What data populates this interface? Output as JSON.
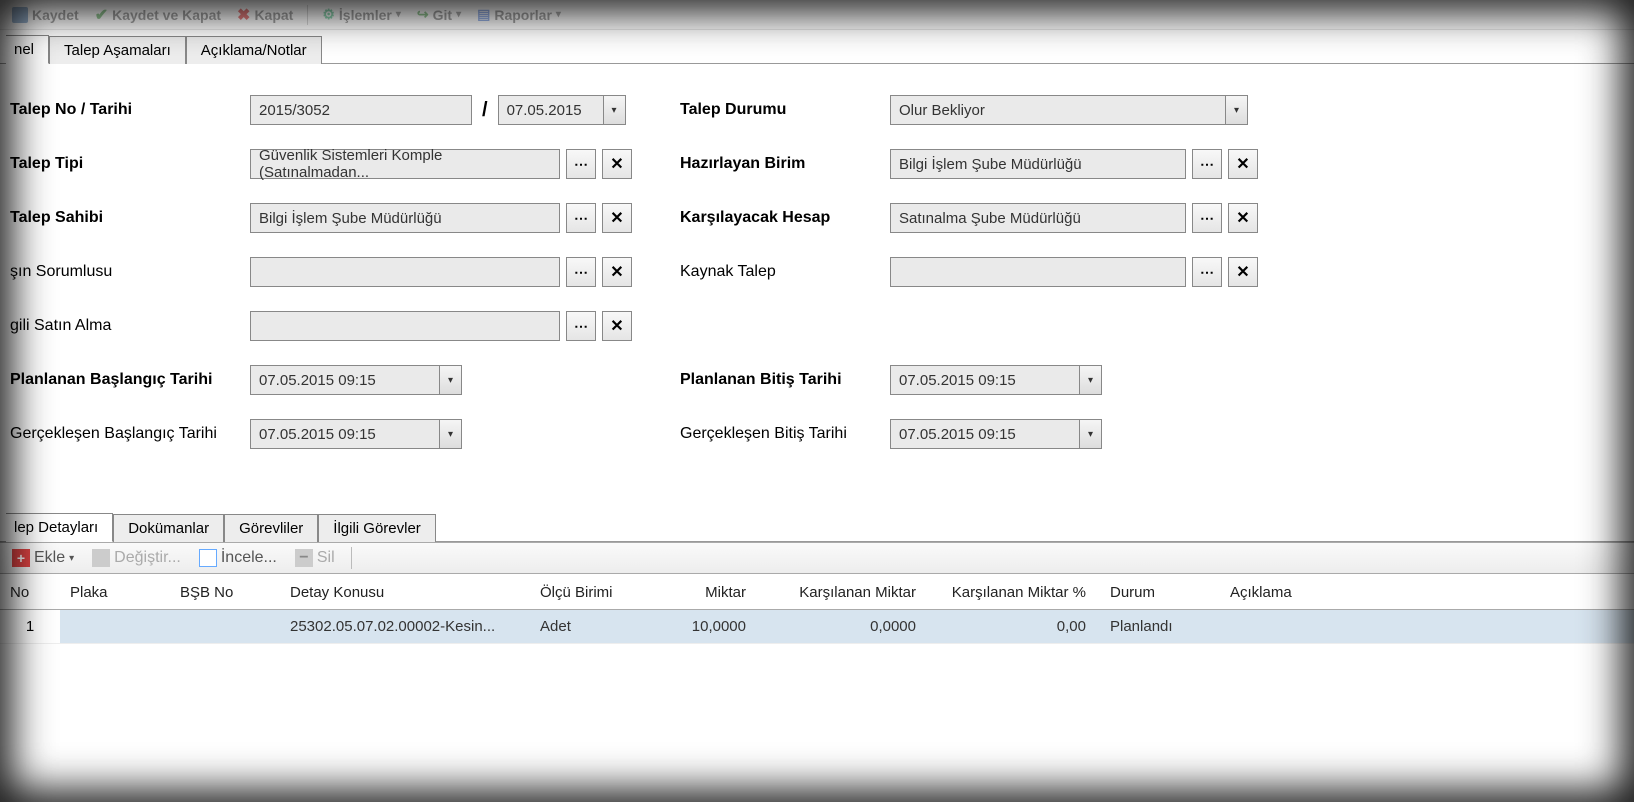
{
  "toolbar": {
    "save": "Kaydet",
    "save_close": "Kaydet ve Kapat",
    "close": "Kapat",
    "ops": "İşlemler",
    "go": "Git",
    "reports": "Raporlar"
  },
  "tabs_main": {
    "general": "nel",
    "stages": "Talep Aşamaları",
    "notes": "Açıklama/Notlar"
  },
  "labels": {
    "talep_no_tarih": "Talep No  / Tarihi",
    "talep_tipi": "Talep Tipi",
    "talep_sahibi": "Talep Sahibi",
    "isin_sorumlusu": "şın Sorumlusu",
    "ilgili_satin_alma": "gili Satın Alma",
    "plan_baslangic": "Planlanan Başlangıç Tarihi",
    "gercek_baslangic": "Gerçekleşen Başlangıç Tarihi",
    "talep_durumu": "Talep Durumu",
    "hazirlayan_birim": "Hazırlayan Birim",
    "karsilayacak_hesap": "Karşılayacak Hesap",
    "kaynak_talep": "Kaynak Talep",
    "plan_bitis": "Planlanan Bitiş Tarihi",
    "gercek_bitis": "Gerçekleşen Bitiş Tarihi"
  },
  "values": {
    "talep_no": "2015/3052",
    "talep_tarihi": "07.05.2015",
    "talep_tipi": "Güvenlik Sistemleri Komple (Satınalmadan...",
    "talep_sahibi": "Bilgi İşlem Şube Müdürlüğü",
    "isin_sorumlusu": "",
    "ilgili_satin_alma": "",
    "plan_baslangic": "07.05.2015 09:15",
    "gercek_baslangic": "07.05.2015 09:15",
    "talep_durumu": "Olur Bekliyor",
    "hazirlayan_birim": "Bilgi İşlem Şube Müdürlüğü",
    "karsilayacak_hesap": "Satınalma Şube Müdürlüğü",
    "kaynak_talep": "",
    "plan_bitis": "07.05.2015 09:15",
    "gercek_bitis": "07.05.2015 09:15"
  },
  "tabs_detail": {
    "details": "lep Detayları",
    "docs": "Dokümanlar",
    "assignees": "Görevliler",
    "related_tasks": "İlgili Görevler"
  },
  "detail_toolbar": {
    "add": "Ekle",
    "edit": "Değiştir...",
    "inspect": "İncele...",
    "del": "Sil"
  },
  "grid": {
    "headers": {
      "no": "No",
      "plaka": "Plaka",
      "bsb": "BŞB No",
      "konu": "Detay Konusu",
      "olcu": "Ölçü Birimi",
      "miktar": "Miktar",
      "kars_miktar": "Karşılanan Miktar",
      "kars_oran": "Karşılanan Miktar %",
      "durum": "Durum",
      "aciklama": "Açıklama"
    },
    "rows": [
      {
        "no": "1",
        "plaka": "",
        "bsb": "",
        "konu": "25302.05.07.02.00002-Kesin...",
        "olcu": "Adet",
        "miktar": "10,0000",
        "kars_miktar": "0,0000",
        "kars_oran": "0,00",
        "durum": "Planlandı",
        "aciklama": ""
      }
    ]
  },
  "glyphs": {
    "dots": "⋯",
    "x": "✕",
    "plus": "+",
    "minus": "−"
  }
}
